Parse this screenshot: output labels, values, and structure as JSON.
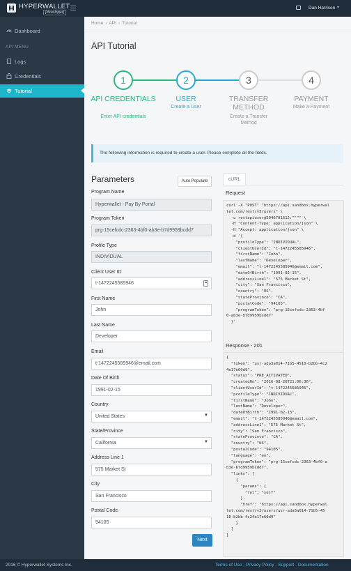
{
  "topbar": {
    "logo_text": "HYPERWALLET",
    "logo_sub": "[developer]",
    "user_name": "Dan Harrison",
    "user_caret": "▾"
  },
  "sidebar": {
    "dashboard": "Dashboard",
    "section": "API MENU",
    "logs": "Logs",
    "credentials": "Credentials",
    "tutorial": "Tutorial"
  },
  "breadcrumb": [
    "Home",
    "API",
    "Tutorial"
  ],
  "breadcrumb_sep": "›",
  "page_title": "API Tutorial",
  "steps": [
    {
      "num": "1",
      "title": "API CREDENTIALS",
      "sub": "Enter API credentials",
      "state": "done"
    },
    {
      "num": "2",
      "title": "USER",
      "sub": "Create a User",
      "state": "active"
    },
    {
      "num": "3",
      "title": "TRANSFER METHOD",
      "sub": "Create a Transfer Method",
      "state": "pending"
    },
    {
      "num": "4",
      "title": "PAYMENT",
      "sub": "Make a Payment",
      "state": "pending"
    }
  ],
  "info_text": "The following information is required to create a user. Please complete all the fields.",
  "form": {
    "title": "Parameters",
    "auto_populate": "Auto Populate",
    "program_name_label": "Program Name",
    "program_name": "Hyperwallet - Pay By Portal",
    "program_token_label": "Program Token",
    "program_token": "prg-15cefcdc-2363-4bf0-ab3e-b7d9959bcdd7",
    "profile_type_label": "Profile Type",
    "profile_type": "INDIVIDUAL",
    "client_user_id_label": "Client User ID",
    "client_user_id": "t-1472245585946",
    "first_name_label": "First Name",
    "first_name": "John",
    "last_name_label": "Last Name",
    "last_name": "Developer",
    "email_label": "Email",
    "email": "t-1472245585946@email.com",
    "dob_label": "Date Of Birth",
    "dob": "1991-02-15",
    "country_label": "Country",
    "country": "United States",
    "state_label": "State/Province",
    "state": "California",
    "address_label": "Address Line 1",
    "address": "575 Market St",
    "city_label": "City",
    "city": "San Francisco",
    "postal_label": "Postal Code",
    "postal": "94105",
    "next": "Next"
  },
  "right": {
    "tab": "cURL",
    "request_label": "Request",
    "request_code": "curl -X \"POST\" \"https://api.sandbox.hyperwal\nlet.com/rest/v3/users\" \\\n  -u restapiuser@5046781612:\"\"\"\" \\\n  -H \"Content-Type: application/json\" \\\n  -H \"Accept: application/json\" \\\n  -d '{\n    \"profileType\": \"INDIVIDUAL\",\n    \"clientUserId\": \"t-1472245585946\",\n    \"firstName\": \"John\",\n    \"lastName\": \"Developer\",\n    \"email\": \"t-1472245585946@email.com\",\n    \"dateOfBirth\": \"1991-02-15\",\n    \"addressLine1\": \"575 Market St\",\n    \"city\": \"San Francisco\",\n    \"country\": \"US\",\n    \"stateProvince\": \"CA\",\n    \"postalCode\": \"94105\",\n    \"programToken\": \"prg-15cefcdc-2363-4bf\n0-ab3e-b7d9959bcdd7\"\n  }'",
    "response_label": "Response - 201",
    "response_code": "{\n  \"token\": \"usr-ada3a014-71b5-4510-b2bb-4c2\n4e17e60d9\",\n  \"status\": \"PRE_ACTIVATED\",\n  \"createdOn\": \"2016-08-26T21:06:36\",\n  \"clientUserId\": \"t-1472245585946\",\n  \"profileType\": \"INDIVIDUAL\",\n  \"firstName\": \"John\",\n  \"lastName\": \"Developer\",\n  \"dateOfBirth\": \"1991-02-15\",\n  \"email\": \"t-1472245585946@email.com\",\n  \"addressLine1\": \"575 Market St\",\n  \"city\": \"San Francisco\",\n  \"stateProvince\": \"CA\",\n  \"country\": \"US\",\n  \"postalCode\": \"94105\",\n  \"language\": \"en\",\n  \"programToken\": \"prg-15cefcdc-2363-4bf0-a\nb3e-b7d9959bcdd7\",\n  \"links\": [\n    {\n      \"params\": {\n        \"rel\": \"self\"\n      },\n      \"href\": \"https://api.sandbox.hyperwal\nlet.com/rest/v3/users/usr-ada3a014-71b5-45\n10-b2bb-4c24e17e60d9\"\n    }\n  ]\n}"
  },
  "footer": {
    "copyright": "2016 © Hyperwallet Systems Inc.",
    "terms": "Terms of Use",
    "privacy": "Privacy Policy",
    "support": "Support",
    "docs": "Documentation",
    "sep": " - "
  },
  "colors": {
    "accent": "#1fb6c9",
    "done_green": "#27b97a",
    "active_teal": "#29a8d8",
    "pending_gray": "#999999",
    "sidebar": "#2b3946",
    "topbar": "#1f2d3a",
    "button": "#2d86c4"
  }
}
